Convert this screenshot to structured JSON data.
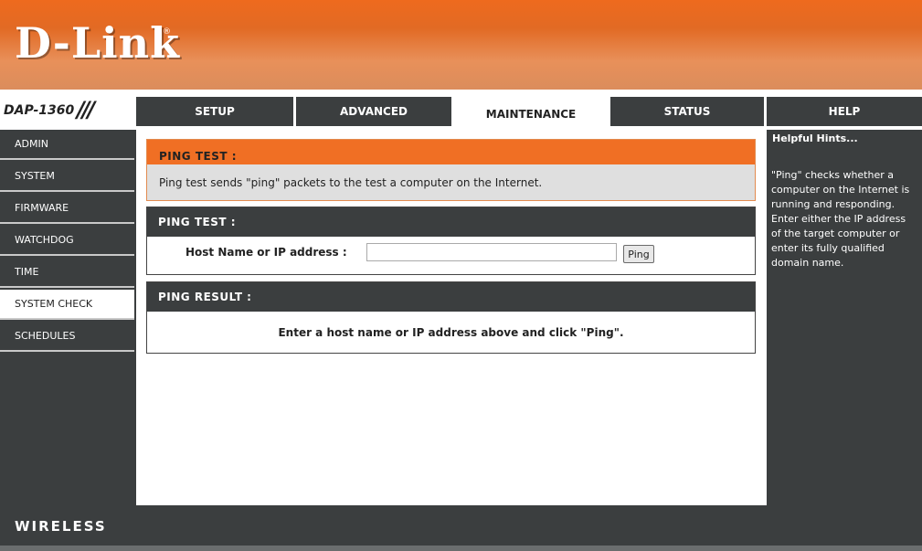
{
  "brand": {
    "logo_text": "D-Link",
    "logo_reg": "®",
    "model": "DAP-1360",
    "model_slashes": "///",
    "accent": "#f06f24",
    "dark": "#3b3e3f"
  },
  "tabs": [
    {
      "label": "SETUP",
      "active": false
    },
    {
      "label": "ADVANCED",
      "active": false
    },
    {
      "label": "MAINTENANCE",
      "active": true
    },
    {
      "label": "STATUS",
      "active": false
    },
    {
      "label": "HELP",
      "active": false
    }
  ],
  "sidebar": {
    "items": [
      {
        "label": "ADMIN",
        "active": false
      },
      {
        "label": "SYSTEM",
        "active": false
      },
      {
        "label": "FIRMWARE",
        "active": false
      },
      {
        "label": "WATCHDOG",
        "active": false
      },
      {
        "label": "TIME",
        "active": false
      },
      {
        "label": "SYSTEM CHECK",
        "active": true
      },
      {
        "label": "SCHEDULES",
        "active": false
      }
    ]
  },
  "main": {
    "intro": {
      "title": "PING TEST :",
      "description": "Ping test sends \"ping\" packets to the test a computer on the Internet."
    },
    "ping_test": {
      "title": "PING TEST :",
      "host_label": "Host Name or IP address :",
      "host_value": "",
      "ping_button": "Ping"
    },
    "ping_result": {
      "title": "PING RESULT :",
      "message": "Enter a host name or IP address above and click \"Ping\"."
    }
  },
  "help": {
    "title": "Helpful Hints...",
    "text": "\"Ping\" checks whether a computer on the Internet is running and responding. Enter either the IP address of the target computer or enter its fully qualified domain name."
  },
  "footer": {
    "text": "WIRELESS"
  }
}
